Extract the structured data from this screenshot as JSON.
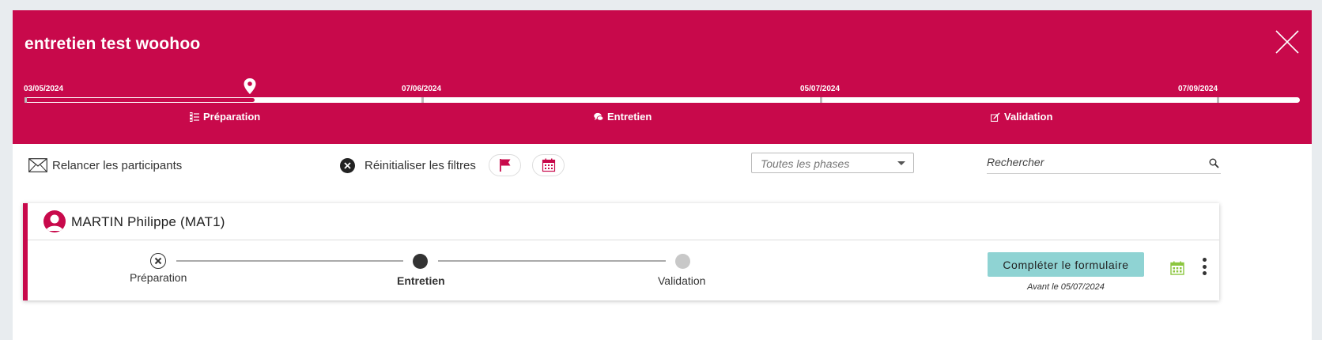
{
  "header": {
    "title": "entretien test woohoo",
    "timeline": {
      "dates": [
        "03/05/2024",
        "07/06/2024",
        "05/07/2024",
        "07/09/2024"
      ],
      "progress_fraction": 0.18,
      "phases": [
        "Préparation",
        "Entretien",
        "Validation"
      ]
    }
  },
  "toolbar": {
    "relancer_label": "Relancer les participants",
    "reset_filters_label": "Réinitialiser les filtres",
    "phase_select_placeholder": "Toutes les phases",
    "search_placeholder": "Rechercher"
  },
  "participant": {
    "name": "MARTIN Philippe (MAT1)",
    "steps": [
      {
        "label": "Préparation",
        "state": "skipped"
      },
      {
        "label": "Entretien",
        "state": "current"
      },
      {
        "label": "Validation",
        "state": "upcoming"
      }
    ],
    "cta_label": "Compléter le formulaire",
    "deadline": "Avant le 05/07/2024"
  },
  "colors": {
    "brand": "#c8094b",
    "cta": "#8fd3d3",
    "calendar_green": "#8cc63f",
    "background": "#e8ecef"
  },
  "icons": [
    "close-icon",
    "map-pin-icon",
    "checklist-icon",
    "chat-icon",
    "sign-icon",
    "envelope-icon",
    "x-circle-icon",
    "flag-icon",
    "calendar-icon",
    "chevron-down-icon",
    "search-icon",
    "user-avatar-icon",
    "kebab-menu-icon"
  ]
}
